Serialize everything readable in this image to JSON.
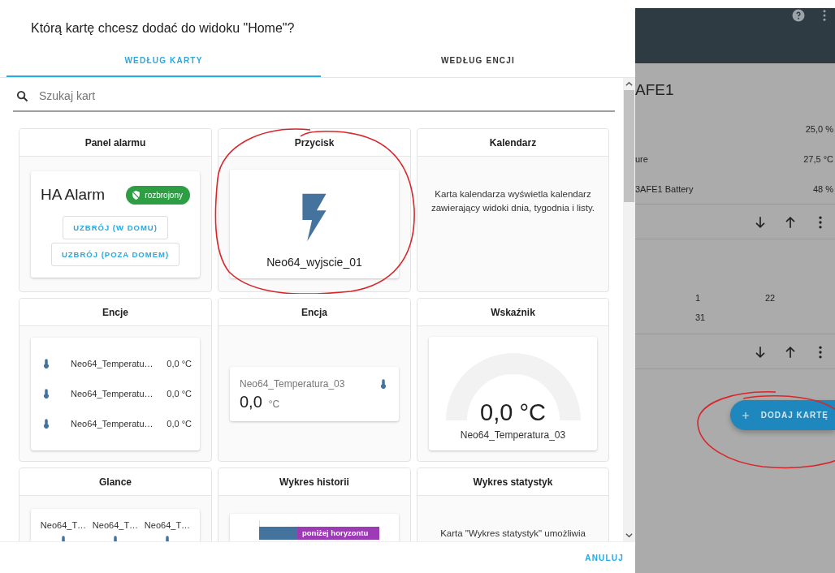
{
  "dialog": {
    "title": "Którą kartę chcesz dodać do widoku \"Home\"?",
    "tabs": [
      {
        "label": "WEDŁUG KARTY",
        "selected": true
      },
      {
        "label": "WEDŁUG ENCJI",
        "selected": false
      }
    ],
    "search": {
      "placeholder": "Szukaj kart"
    },
    "cards": [
      {
        "title": "Panel alarmu",
        "kind": "alarm",
        "name": "HA Alarm",
        "badge": "rozbrojony",
        "buttons": [
          "UZBRÓJ (W DOMU)",
          "UZBRÓJ (POZA DOMEM)"
        ]
      },
      {
        "title": "Przycisk",
        "kind": "button",
        "name": "Neo64_wyjscie_01"
      },
      {
        "title": "Kalendarz",
        "kind": "description",
        "text": "Karta kalendarza wyświetla kalendarz zawierający widoki dnia, tygodnia i listy."
      },
      {
        "title": "Encje",
        "kind": "entities",
        "rows": [
          {
            "name": "Neo64_Temperatu…",
            "value": "0,0 °C"
          },
          {
            "name": "Neo64_Temperatu…",
            "value": "0,0 °C"
          },
          {
            "name": "Neo64_Temperatu…",
            "value": "0,0 °C"
          }
        ]
      },
      {
        "title": "Encja",
        "kind": "entity",
        "name": "Neo64_Temperatura_03",
        "value": "0,0",
        "unit": "°C"
      },
      {
        "title": "Wskaźnik",
        "kind": "gauge",
        "value": "0,0 °C",
        "name": "Neo64_Temperatura_03"
      },
      {
        "title": "Glance",
        "kind": "glance",
        "names": [
          "Neo64_T…",
          "Neo64_T…",
          "Neo64_T…"
        ]
      },
      {
        "title": "Wykres historii",
        "kind": "history",
        "bar_label": "poniżej horyzontu"
      },
      {
        "title": "Wykres statystyk",
        "kind": "description",
        "text": "Karta \"Wykres statystyk\" umożliwia"
      }
    ],
    "cancel": "ANULUJ"
  },
  "background": {
    "title": "AFE1",
    "rows": [
      {
        "value": "25,0 %"
      },
      {
        "name": "ure",
        "value": "27,5 °C"
      },
      {
        "name": "3AFE1 Battery",
        "value": "48 %"
      }
    ],
    "calendar_rows": [
      [
        "1",
        "22"
      ],
      [
        "31"
      ]
    ],
    "fab": "DODAJ KARTĘ"
  }
}
